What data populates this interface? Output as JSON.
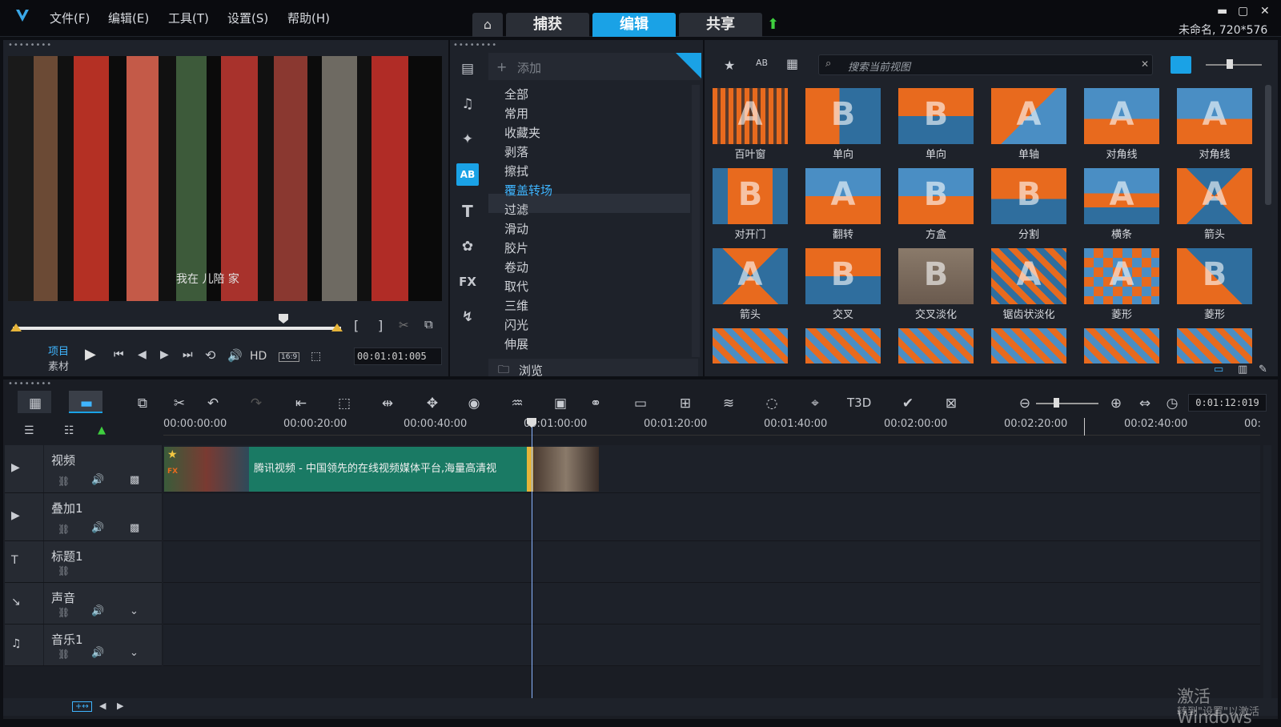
{
  "menu": [
    "文件(F)",
    "编辑(E)",
    "工具(T)",
    "设置(S)",
    "帮助(H)"
  ],
  "tabs": {
    "capture": "捕获",
    "edit": "编辑",
    "share": "共享"
  },
  "project_info": "未命名, 720*576",
  "library": {
    "add_label": "添加",
    "search_placeholder": "搜索当前视图",
    "categories": [
      "全部",
      "常用",
      "收藏夹",
      "剥落",
      "擦拭",
      "覆盖转场",
      "过滤",
      "滑动",
      "胶片",
      "卷动",
      "取代",
      "三维",
      "闪光",
      "伸展"
    ],
    "selected_category": "覆盖转场",
    "browse_label": "浏览",
    "thumbs": [
      "百叶窗",
      "单向",
      "单向",
      "单轴",
      "对角线",
      "对角线",
      "对开门",
      "翻转",
      "方盒",
      "分割",
      "横条",
      "箭头",
      "箭头",
      "交叉",
      "交叉淡化",
      "锯齿状淡化",
      "菱形",
      "菱形"
    ]
  },
  "player": {
    "project_label": "项目",
    "clip_label": "素材",
    "hd_label": "HD",
    "aspect_label": "16:9",
    "timecode": "00:01:01:005",
    "subtitle": "我在  儿陪  家"
  },
  "timeline": {
    "timecode": "0:01:12:019",
    "ruler": [
      "00:00:00:00",
      "00:00:20:00",
      "00:00:40:00",
      "00:01:00:00",
      "00:01:20:00",
      "00:01:40:00",
      "00:02:00:00",
      "00:02:20:00",
      "00:02:40:00",
      "00:"
    ],
    "tracks": [
      "视频",
      "叠加1",
      "标题1",
      "声音",
      "音乐1"
    ],
    "clip_title": "腾讯视频 - 中国领先的在线视频媒体平台,海量高清视"
  },
  "watermark": {
    "line1": "激活 Windows",
    "line2": "转到\"设置\"以激活"
  },
  "colors": {
    "accent": "#1aa2e6",
    "clip": "#1a7a64",
    "orange": "#e86a1e",
    "sky": "#2f6e9e"
  }
}
